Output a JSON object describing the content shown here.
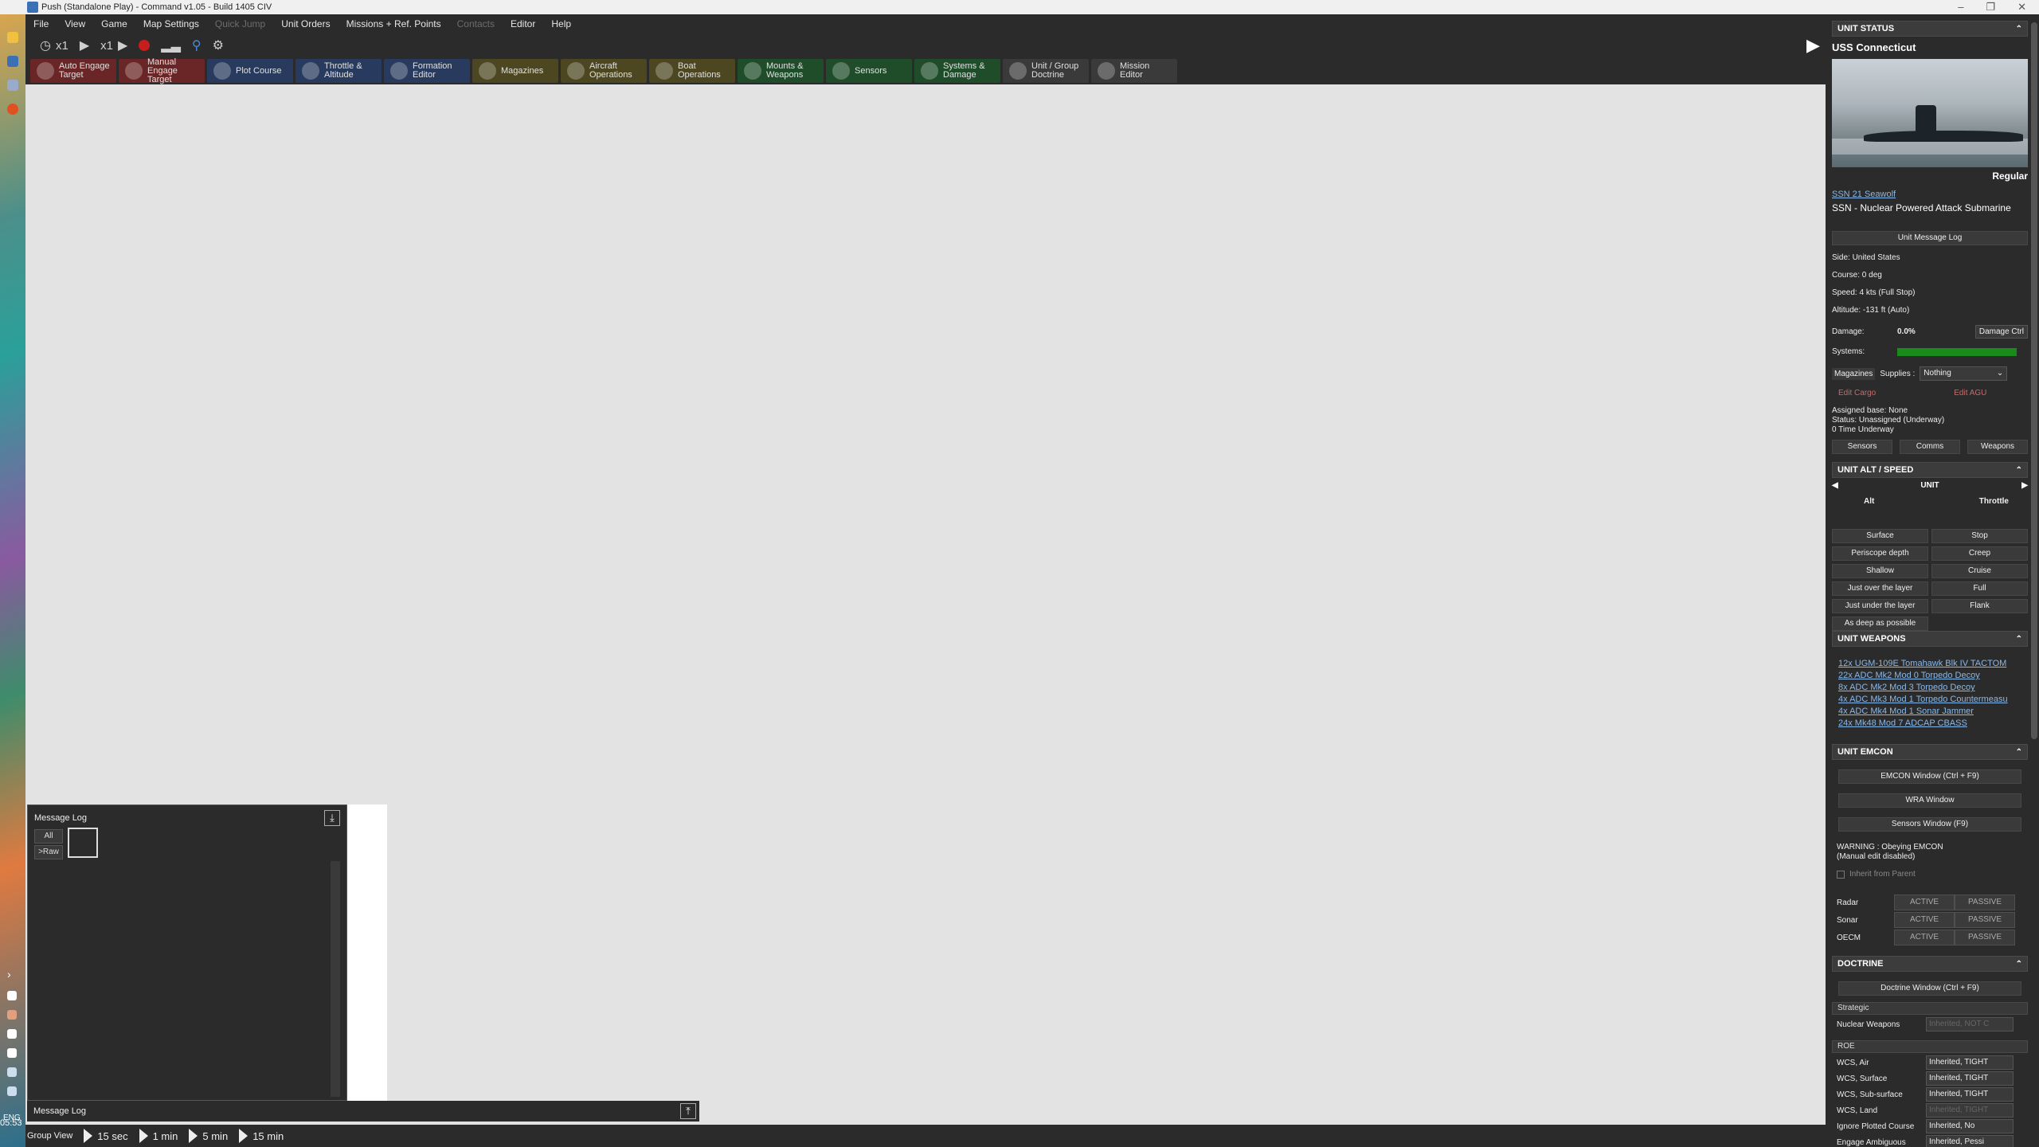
{
  "window": {
    "title": "Push (Standalone Play) - Command v1.05 - Build 1405 CIV"
  },
  "menu": [
    {
      "label": "File",
      "enabled": true
    },
    {
      "label": "View",
      "enabled": true
    },
    {
      "label": "Game",
      "enabled": true
    },
    {
      "label": "Map Settings",
      "enabled": true
    },
    {
      "label": "Quick Jump",
      "enabled": false
    },
    {
      "label": "Unit Orders",
      "enabled": true
    },
    {
      "label": "Missions + Ref. Points",
      "enabled": true
    },
    {
      "label": "Contacts",
      "enabled": false
    },
    {
      "label": "Editor",
      "enabled": true
    },
    {
      "label": "Help",
      "enabled": true
    }
  ],
  "controls": {
    "compression1": "x1",
    "compression2": "x1"
  },
  "toolbar": [
    {
      "label": "Auto Engage Target",
      "theme": "red",
      "icon": "crosshair-icon"
    },
    {
      "label": "Manual Engage Target",
      "theme": "red",
      "icon": "target-icon"
    },
    {
      "label": "Plot Course",
      "theme": "blue",
      "icon": "compass-icon"
    },
    {
      "label": "Throttle & Altitude",
      "theme": "blue",
      "icon": "throttle-icon"
    },
    {
      "label": "Formation Editor",
      "theme": "blue",
      "icon": "formation-icon"
    },
    {
      "label": "Magazines",
      "theme": "olive",
      "icon": "magazine-icon"
    },
    {
      "label": "Aircraft Operations",
      "theme": "olive",
      "icon": "aircraft-icon"
    },
    {
      "label": "Boat Operations",
      "theme": "olive",
      "icon": "boat-icon"
    },
    {
      "label": "Mounts & Weapons",
      "theme": "green",
      "icon": "weapons-icon"
    },
    {
      "label": "Sensors",
      "theme": "green",
      "icon": "radar-icon"
    },
    {
      "label": "Systems & Damage",
      "theme": "green",
      "icon": "gear-icon"
    },
    {
      "label": "Unit / Group Doctrine",
      "theme": "gray",
      "icon": "doctrine-icon"
    },
    {
      "label": "Mission Editor",
      "theme": "gray",
      "icon": "mission-icon"
    }
  ],
  "message_log": {
    "title": "Message Log",
    "filter_all": "All",
    "filter_raw": ">Raw",
    "bottom_title": "Message Log"
  },
  "status_bar": {
    "view": "Group View",
    "time_steps": [
      "15 sec",
      "1 min",
      "5 min",
      "15 min"
    ]
  },
  "taskbar": {
    "lang": "ENG",
    "clock": "05:53"
  },
  "unit_status": {
    "header": "UNIT STATUS",
    "name": "USS Connecticut",
    "proficiency": "Regular",
    "class_link": "SSN 21 Seawolf",
    "type": "SSN - Nuclear Powered Attack Submarine",
    "message_log_btn": "Unit Message Log",
    "side": "Side: United States",
    "course": "Course: 0 deg",
    "speed": "Speed: 4 kts (Full Stop)",
    "altitude": "Altitude: -131 ft (Auto)",
    "damage_label": "Damage:",
    "damage_value": "0.0%",
    "damage_btn": "Damage Ctrl",
    "systems_label": "Systems:",
    "systems_health": 1.0,
    "systems_color": "#1a8a1a",
    "magazines_btn": "Magazines",
    "supplies_label": "Supplies :",
    "supplies_value": "Nothing",
    "edit_cargo": "Edit Cargo",
    "edit_agu": "Edit AGU",
    "assigned_base": "Assigned base: None",
    "status": "Status: Unassigned (Underway)",
    "time_underway": "0 Time Underway",
    "tabs": [
      "Sensors",
      "Comms",
      "Weapons"
    ]
  },
  "alt_speed": {
    "header": "UNIT ALT / SPEED",
    "unit_label": "UNIT",
    "alt_label": "Alt",
    "throttle_label": "Throttle",
    "rows": [
      [
        "Surface",
        "Stop"
      ],
      [
        "Periscope depth",
        "Creep"
      ],
      [
        "Shallow",
        "Cruise"
      ],
      [
        "Just over the layer",
        "Full"
      ],
      [
        "Just under the layer",
        "Flank"
      ],
      [
        "As deep as possible",
        ""
      ]
    ]
  },
  "weapons": {
    "header": "UNIT WEAPONS",
    "items": [
      "12x UGM-109E Tomahawk Blk IV TACTOM",
      "22x ADC Mk2 Mod 0 Torpedo Decoy",
      "8x ADC Mk2 Mod 3 Torpedo Decoy",
      "4x ADC Mk3 Mod 1 Torpedo Countermeasu",
      "4x ADC Mk4 Mod 1 Sonar Jammer",
      "24x Mk48 Mod 7 ADCAP CBASS"
    ]
  },
  "emcon": {
    "header": "UNIT EMCON",
    "emcon_btn": "EMCON Window (Ctrl + F9)",
    "wra_btn": "WRA Window",
    "sensors_btn": "Sensors Window (F9)",
    "warning": "WARNING : Obeying EMCON",
    "warning2": "(Manual edit disabled)",
    "inherit": "Inherit from Parent",
    "rows": [
      {
        "label": "Radar",
        "active": "ACTIVE",
        "passive": "PASSIVE"
      },
      {
        "label": "Sonar",
        "active": "ACTIVE",
        "passive": "PASSIVE"
      },
      {
        "label": "OECM",
        "active": "ACTIVE",
        "passive": "PASSIVE"
      }
    ]
  },
  "doctrine": {
    "header": "DOCTRINE",
    "window_btn": "Doctrine Window (Ctrl + F9)",
    "strategic_label": "Strategic",
    "nuclear_label": "Nuclear Weapons",
    "nuclear_value": "Inherited, NOT C",
    "roe_label": "ROE",
    "rows": [
      {
        "label": "WCS, Air",
        "value": "Inherited, TIGHT",
        "enabled": true
      },
      {
        "label": "WCS, Surface",
        "value": "Inherited, TIGHT",
        "enabled": true
      },
      {
        "label": "WCS, Sub-surface",
        "value": "Inherited, TIGHT",
        "enabled": true
      },
      {
        "label": "WCS, Land",
        "value": "Inherited, TIGHT",
        "enabled": false
      },
      {
        "label": "Ignore Plotted Course",
        "value": "Inherited, No",
        "enabled": true
      },
      {
        "label": "Engage Ambiguous",
        "value": "Inherited, Pessi",
        "enabled": true
      }
    ]
  }
}
